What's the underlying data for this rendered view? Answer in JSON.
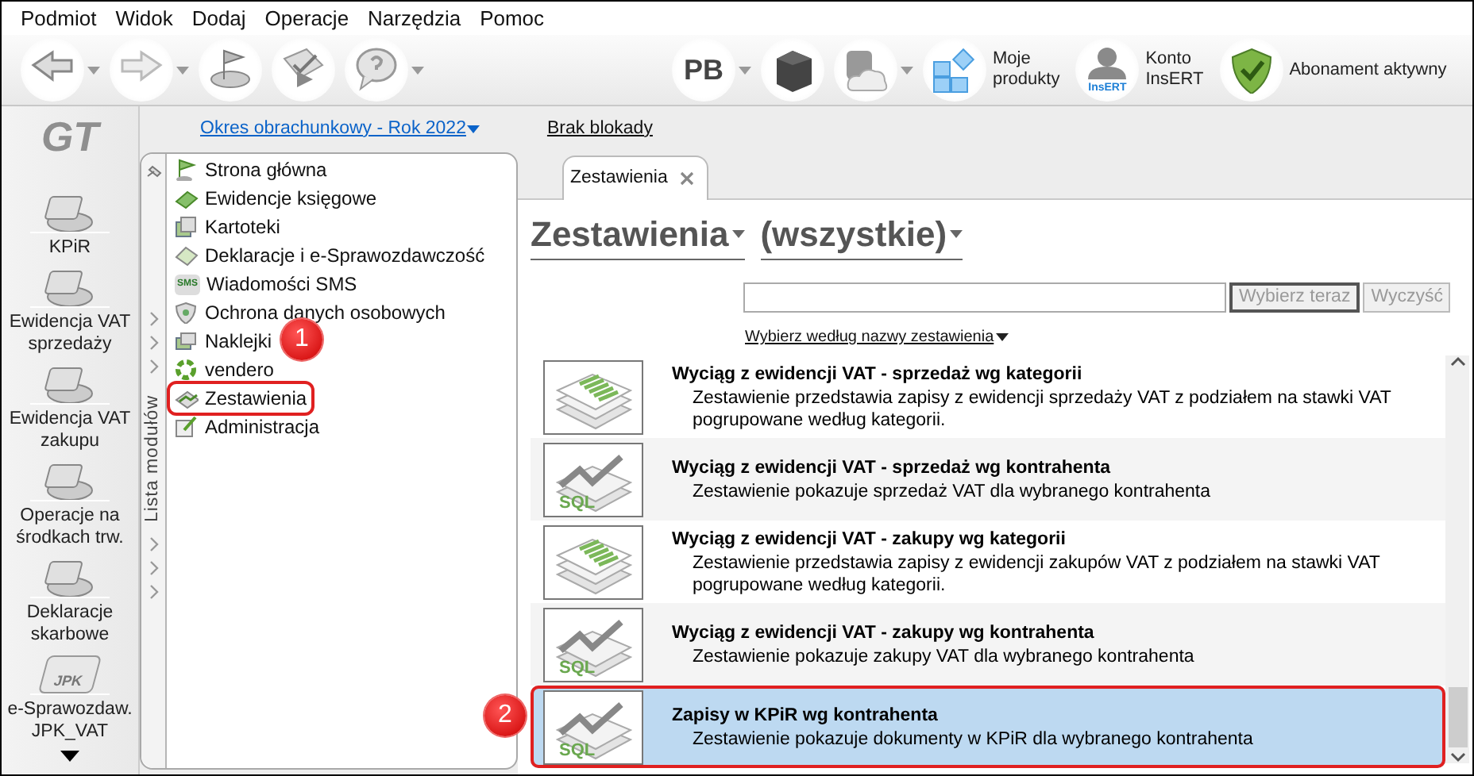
{
  "menu_bar": [
    "Podmiot",
    "Widok",
    "Dodaj",
    "Operacje",
    "Narzędzia",
    "Pomoc"
  ],
  "toolbar": [
    {
      "kind": "icon",
      "caret": true
    },
    {
      "kind": "icon",
      "caret": true
    },
    {
      "kind": "icon",
      "caret": false
    },
    {
      "kind": "icon",
      "caret": false
    },
    {
      "kind": "icon",
      "caret": true
    },
    {
      "kind": "glyph",
      "label": "PB",
      "caret": true
    },
    {
      "kind": "icon",
      "caret": false
    },
    {
      "kind": "icon",
      "caret": true
    },
    {
      "kind": "labeled",
      "label": "Moje\nprodukty"
    },
    {
      "kind": "labeled",
      "label": "Konto\nInsERT",
      "logo_text": "InsERT"
    },
    {
      "kind": "labeled",
      "label": "Abonament aktywny"
    }
  ],
  "period": "Okres obrachunkowy - Rok 2022",
  "lock_status": "Brak blokady",
  "sidebar": {
    "logo": "GT",
    "items": [
      {
        "label": "KPiR"
      },
      {
        "label": "Ewidencja VAT\nsprzedaży"
      },
      {
        "label": "Ewidencja VAT\nzakupu"
      },
      {
        "label": "Operacje na\nśrodkach trw."
      },
      {
        "label": "Deklaracje\nskarbowe"
      },
      {
        "label": "e-Sprawozdaw.\nJPK_VAT",
        "icon_text": "JPK"
      }
    ]
  },
  "modules": {
    "title": "Lista modułów",
    "items": [
      {
        "label": "Strona główna",
        "highlighted": false
      },
      {
        "label": "Ewidencje księgowe",
        "highlighted": false
      },
      {
        "label": "Kartoteki",
        "highlighted": false
      },
      {
        "label": "Deklaracje i e-Sprawozdawczość",
        "highlighted": false
      },
      {
        "label": "Wiadomości SMS",
        "icon_text": "SMS",
        "highlighted": false
      },
      {
        "label": "Ochrona danych osobowych",
        "highlighted": false
      },
      {
        "label": "Naklejki",
        "highlighted": false
      },
      {
        "label": "vendero",
        "highlighted": false
      },
      {
        "label": "Zestawienia",
        "highlighted": true
      },
      {
        "label": "Administracja",
        "highlighted": false
      }
    ]
  },
  "tabs": [
    {
      "label": "Zestawienia",
      "selected": true
    }
  ],
  "heading": {
    "category": "Zestawienia",
    "filter": "(wszystkie)"
  },
  "buttons": [
    {
      "label": "Wybierz teraz",
      "default": true
    },
    {
      "label": "Wyczyść",
      "default": false
    }
  ],
  "search_mode": "Wybierz według nazwy zestawienia",
  "reports": [
    {
      "kind": "list",
      "title": "Wyciąg z ewidencji VAT - sprzedaż wg kategorii",
      "description": "Zestawienie przedstawia zapisy z ewidencji sprzedaży VAT z podziałem na stawki VAT pogrupowane według kategorii.",
      "selected": false,
      "highlighted": false
    },
    {
      "kind": "sql",
      "icon_text": "SQL",
      "title": "Wyciąg z ewidencji VAT - sprzedaż wg kontrahenta",
      "description": "Zestawienie pokazuje sprzedaż VAT dla wybranego kontrahenta",
      "selected": false,
      "highlighted": false
    },
    {
      "kind": "list",
      "title": "Wyciąg z ewidencji VAT - zakupy wg kategorii",
      "description": "Zestawienie przedstawia zapisy z ewidencji zakupów VAT z podziałem na stawki VAT pogrupowane według kategorii.",
      "selected": false,
      "highlighted": false
    },
    {
      "kind": "sql",
      "icon_text": "SQL",
      "title": "Wyciąg z ewidencji VAT - zakupy wg kontrahenta",
      "description": "Zestawienie pokazuje zakupy VAT dla wybranego kontrahenta",
      "selected": false,
      "highlighted": false
    },
    {
      "kind": "sql",
      "icon_text": "SQL",
      "title": "Zapisy w KPiR wg kontrahenta",
      "description": "Zestawienie pokazuje dokumenty w KPiR dla wybranego kontrahenta",
      "selected": true,
      "highlighted": true
    }
  ],
  "annotations": [
    {
      "label": "1"
    },
    {
      "label": "2"
    }
  ]
}
